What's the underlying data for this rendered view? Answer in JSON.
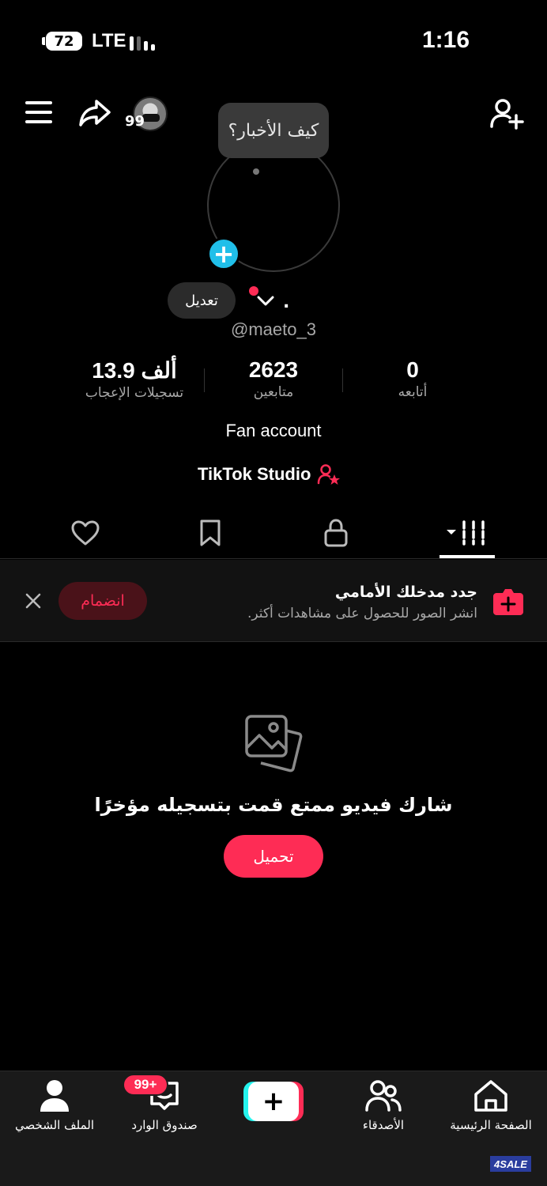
{
  "status_bar": {
    "battery": "72",
    "network": "LTE",
    "time": "1:16"
  },
  "header": {
    "notif_count": "99"
  },
  "bubble": {
    "text": "كيف الأخبار؟"
  },
  "profile": {
    "edit_label": "تعديل",
    "name": ".",
    "username": "@maeto_3",
    "bio": "Fan account",
    "studio_label": "TikTok Studio"
  },
  "stats": [
    {
      "value": "13.9 ألف",
      "label": "تسجيلات الإعجاب"
    },
    {
      "value": "2623",
      "label": "متابعين"
    },
    {
      "value": "0",
      "label": "أتابعه"
    }
  ],
  "tabs": [
    "videos-grid",
    "private",
    "saved",
    "liked"
  ],
  "banner": {
    "title": "جدد مدخلك الأمامي",
    "subtitle": "انشر الصور للحصول على مشاهدات أكثر.",
    "join_label": "انضمام"
  },
  "empty_state": {
    "text": "شارك فيديو ممتع قمت بتسجيله مؤخرًا",
    "upload_label": "تحميل"
  },
  "bottom_nav": {
    "profile": "الملف الشخصي",
    "inbox": "صندوق الوارد",
    "inbox_badge": "99+",
    "friends": "الأصدقاء",
    "home": "الصفحة الرئيسية"
  },
  "watermark": "4SALE",
  "colors": {
    "accent": "#fe2c55",
    "add_photo": "#20bfe9",
    "background": "#000000"
  }
}
